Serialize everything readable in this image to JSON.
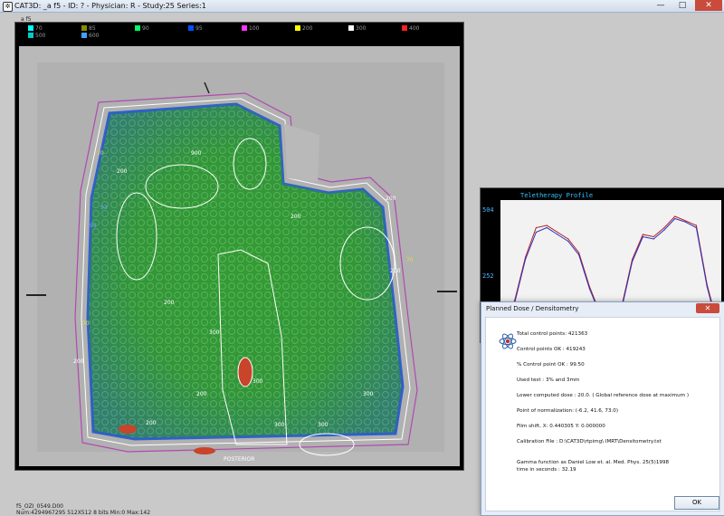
{
  "window": {
    "title": "CAT3D: _a f5 - ID: ? - Physician: R - Study:25 Series:1",
    "minimize": "—",
    "maximize": "□",
    "close": "✕"
  },
  "viewer": {
    "file_label": "_a f5",
    "legend": [
      {
        "value": "70",
        "color": "#00ffff"
      },
      {
        "value": "85",
        "color": "#8a8a00"
      },
      {
        "value": "90",
        "color": "#00ff66"
      },
      {
        "value": "95",
        "color": "#0050ff"
      },
      {
        "value": "100",
        "color": "#ff33ff"
      },
      {
        "value": "200",
        "color": "#ffff00"
      },
      {
        "value": "300",
        "color": "#ffffff"
      },
      {
        "value": "400",
        "color": "#ff2020"
      },
      {
        "value": "500",
        "color": "#00cccc"
      },
      {
        "value": "600",
        "color": "#40a0ff"
      }
    ],
    "posterior_label": "POSTERIOR",
    "contour_labels": [
      "200",
      "200",
      "200",
      "900",
      "300",
      "300",
      "300",
      "300",
      "300",
      "200",
      "200",
      "200",
      "200",
      "200",
      "70",
      "70",
      "70",
      "93",
      "93"
    ],
    "status_line1": "f5_OZI_0549.D00",
    "status_line2": "Num:4294967295 512X512 8 bits Min:0 Max:142"
  },
  "profile": {
    "title": "Teletherapy Profile",
    "y_tick_high": "504",
    "y_tick_mid": "252",
    "chart_data": {
      "type": "line",
      "title": "Teletherapy Profile",
      "ytick_labels": [
        "504",
        "252"
      ],
      "series": [
        {
          "color": "#b22020",
          "x": [
            0,
            5,
            10,
            15,
            20,
            25,
            30,
            35,
            40,
            45,
            50,
            55,
            60,
            65,
            70,
            75,
            80,
            85,
            90,
            95,
            100
          ],
          "values": [
            40,
            150,
            340,
            470,
            480,
            450,
            420,
            360,
            210,
            90,
            70,
            120,
            330,
            440,
            430,
            470,
            520,
            500,
            480,
            220,
            40
          ]
        },
        {
          "color": "#3030c0",
          "x": [
            0,
            5,
            10,
            15,
            20,
            25,
            30,
            35,
            40,
            45,
            50,
            55,
            60,
            65,
            70,
            75,
            80,
            85,
            90,
            95,
            100
          ],
          "values": [
            30,
            140,
            330,
            450,
            470,
            440,
            410,
            350,
            200,
            85,
            60,
            110,
            320,
            430,
            420,
            460,
            510,
            495,
            470,
            210,
            30
          ]
        }
      ]
    }
  },
  "dialog": {
    "title": "Planned Dose / Densitometry",
    "total_control_points": "Total control points: 421363",
    "control_points_ok": "Control points OK : 419243",
    "pct_control_ok": "% Control point OK : 99.50",
    "used_test": "Used test : 3% and 3mm",
    "lower_computed_dose": "Lower computed dose : 20.0. ( Global reference dose at maximum )",
    "normalization": "Point of normalization: (-6.2, 41.6, 73.0)",
    "film_shift": "Film shift, X: 0.440305  Y: 0.000000",
    "calibration_file": "Calibration File : D:\\CAT3D\\rtpimg\\ IMRT\\Densitometry.txt",
    "gamma_ref": "Gamma function as Daniel Low et. al. Med. Phys. 25(5)1998",
    "time": "time in seconds : 32.19",
    "ok_label": "OK"
  }
}
